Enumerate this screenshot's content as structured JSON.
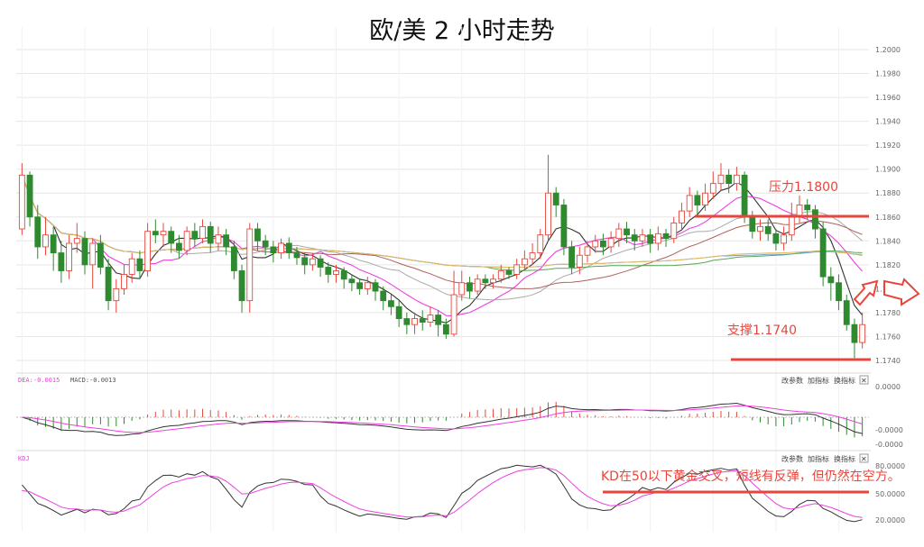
{
  "title": "欧/美 2 小时走势",
  "chart_data": [
    {
      "type": "candlestick",
      "panel": "price",
      "ylim": [
        1.174,
        1.2
      ],
      "yticks": [
        "1.2000",
        "1.1980",
        "1.1960",
        "1.1940",
        "1.1920",
        "1.1900",
        "1.1880",
        "1.1860",
        "1.1840",
        "1.1820",
        "1.1800",
        "1.1780",
        "1.1760",
        "1.1740"
      ],
      "candles": [
        [
          1.185,
          1.1895,
          1.1905,
          1.1845
        ],
        [
          1.1895,
          1.186,
          1.1898,
          1.1852
        ],
        [
          1.186,
          1.1835,
          1.187,
          1.1825
        ],
        [
          1.1835,
          1.1845,
          1.186,
          1.1828
        ],
        [
          1.1845,
          1.183,
          1.1852,
          1.1815
        ],
        [
          1.183,
          1.1815,
          1.184,
          1.1805
        ],
        [
          1.1815,
          1.1838,
          1.1845,
          1.1808
        ],
        [
          1.1838,
          1.1842,
          1.1855,
          1.183
        ],
        [
          1.1842,
          1.182,
          1.1848,
          1.1812
        ],
        [
          1.182,
          1.1838,
          1.1842,
          1.18
        ],
        [
          1.1838,
          1.1818,
          1.1845,
          1.1812
        ],
        [
          1.1818,
          1.179,
          1.1825,
          1.1782
        ],
        [
          1.179,
          1.18,
          1.1808,
          1.178
        ],
        [
          1.18,
          1.1812,
          1.182,
          1.1795
        ],
        [
          1.1812,
          1.1825,
          1.183,
          1.1805
        ],
        [
          1.1825,
          1.1815,
          1.1832,
          1.1808
        ],
        [
          1.1815,
          1.1848,
          1.1855,
          1.181
        ],
        [
          1.1848,
          1.1845,
          1.1858,
          1.1838
        ],
        [
          1.1845,
          1.1848,
          1.1855,
          1.1835
        ],
        [
          1.1848,
          1.1838,
          1.1852,
          1.183
        ],
        [
          1.1838,
          1.1832,
          1.1845,
          1.1825
        ],
        [
          1.1832,
          1.1848,
          1.1852,
          1.1828
        ],
        [
          1.1848,
          1.1842,
          1.1855,
          1.1835
        ],
        [
          1.1842,
          1.1852,
          1.1858,
          1.1838
        ],
        [
          1.1852,
          1.1838,
          1.1856,
          1.183
        ],
        [
          1.1838,
          1.1845,
          1.1852,
          1.1832
        ],
        [
          1.1845,
          1.1835,
          1.185,
          1.1828
        ],
        [
          1.1835,
          1.1815,
          1.184,
          1.1808
        ],
        [
          1.1815,
          1.179,
          1.182,
          1.178
        ],
        [
          1.179,
          1.185,
          1.1855,
          1.178
        ],
        [
          1.185,
          1.184,
          1.1855,
          1.1832
        ],
        [
          1.184,
          1.1835,
          1.1845,
          1.1828
        ],
        [
          1.1835,
          1.183,
          1.184,
          1.1822
        ],
        [
          1.183,
          1.1838,
          1.1842,
          1.1825
        ],
        [
          1.1838,
          1.183,
          1.1843,
          1.1825
        ],
        [
          1.183,
          1.1826,
          1.1835,
          1.182
        ],
        [
          1.1826,
          1.182,
          1.183,
          1.1812
        ],
        [
          1.182,
          1.1825,
          1.183,
          1.1815
        ],
        [
          1.1825,
          1.1818,
          1.1828,
          1.181
        ],
        [
          1.1818,
          1.1812,
          1.1822,
          1.1805
        ],
        [
          1.1812,
          1.1815,
          1.182,
          1.1805
        ],
        [
          1.1815,
          1.1808,
          1.1818,
          1.18
        ],
        [
          1.1808,
          1.1805,
          1.1812,
          1.1798
        ],
        [
          1.1805,
          1.18,
          1.1808,
          1.1795
        ],
        [
          1.18,
          1.1805,
          1.181,
          1.1795
        ],
        [
          1.1805,
          1.1798,
          1.1808,
          1.179
        ],
        [
          1.1798,
          1.179,
          1.1802,
          1.1782
        ],
        [
          1.179,
          1.1785,
          1.1795,
          1.1778
        ],
        [
          1.1785,
          1.1775,
          1.179,
          1.1768
        ],
        [
          1.1775,
          1.177,
          1.178,
          1.1762
        ],
        [
          1.177,
          1.1775,
          1.178,
          1.1762
        ],
        [
          1.1775,
          1.1772,
          1.1782,
          1.1765
        ],
        [
          1.1772,
          1.1778,
          1.1785,
          1.1768
        ],
        [
          1.1778,
          1.177,
          1.1782,
          1.176
        ],
        [
          1.177,
          1.1762,
          1.1775,
          1.1758
        ],
        [
          1.1762,
          1.1795,
          1.1815,
          1.176
        ],
        [
          1.1795,
          1.1805,
          1.1815,
          1.179
        ],
        [
          1.1805,
          1.1798,
          1.181,
          1.1792
        ],
        [
          1.1798,
          1.1808,
          1.1812,
          1.1795
        ],
        [
          1.1808,
          1.1805,
          1.1812,
          1.18
        ],
        [
          1.1805,
          1.1808,
          1.1812,
          1.18
        ],
        [
          1.1808,
          1.1815,
          1.182,
          1.1805
        ],
        [
          1.1815,
          1.1812,
          1.1818,
          1.1808
        ],
        [
          1.1812,
          1.182,
          1.1825,
          1.1808
        ],
        [
          1.182,
          1.1825,
          1.1832,
          1.1815
        ],
        [
          1.1825,
          1.183,
          1.1838,
          1.182
        ],
        [
          1.183,
          1.1845,
          1.185,
          1.1825
        ],
        [
          1.1845,
          1.188,
          1.1912,
          1.184
        ],
        [
          1.188,
          1.187,
          1.1885,
          1.186
        ],
        [
          1.187,
          1.1835,
          1.1875,
          1.1828
        ],
        [
          1.1835,
          1.1818,
          1.184,
          1.1812
        ],
        [
          1.1818,
          1.1828,
          1.1835,
          1.1812
        ],
        [
          1.1828,
          1.1835,
          1.184,
          1.1822
        ],
        [
          1.1835,
          1.184,
          1.1845,
          1.183
        ],
        [
          1.184,
          1.1835,
          1.1846,
          1.1828
        ],
        [
          1.1835,
          1.1842,
          1.1848,
          1.183
        ],
        [
          1.1842,
          1.185,
          1.1855,
          1.1835
        ],
        [
          1.185,
          1.1845,
          1.1856,
          1.1838
        ],
        [
          1.1845,
          1.184,
          1.185,
          1.1832
        ],
        [
          1.184,
          1.1845,
          1.185,
          1.1835
        ],
        [
          1.1845,
          1.1838,
          1.185,
          1.183
        ],
        [
          1.1838,
          1.1846,
          1.1852,
          1.1832
        ],
        [
          1.1846,
          1.1842,
          1.185,
          1.1835
        ],
        [
          1.1842,
          1.1855,
          1.186,
          1.1838
        ],
        [
          1.1855,
          1.1865,
          1.1872,
          1.185
        ],
        [
          1.1865,
          1.1878,
          1.1885,
          1.186
        ],
        [
          1.1878,
          1.187,
          1.1882,
          1.1862
        ],
        [
          1.187,
          1.188,
          1.1888,
          1.1865
        ],
        [
          1.188,
          1.1888,
          1.1898,
          1.1875
        ],
        [
          1.1888,
          1.1895,
          1.1905,
          1.1882
        ],
        [
          1.1895,
          1.1888,
          1.19,
          1.188
        ],
        [
          1.1888,
          1.1895,
          1.1902,
          1.1882
        ],
        [
          1.1895,
          1.186,
          1.1898,
          1.1855
        ],
        [
          1.186,
          1.1848,
          1.1865,
          1.1842
        ],
        [
          1.1848,
          1.1852,
          1.1858,
          1.184
        ],
        [
          1.1852,
          1.1846,
          1.1858,
          1.184
        ],
        [
          1.1846,
          1.1838,
          1.185,
          1.1832
        ],
        [
          1.1838,
          1.1845,
          1.1852,
          1.1832
        ],
        [
          1.1845,
          1.186,
          1.1872,
          1.184
        ],
        [
          1.186,
          1.187,
          1.1878,
          1.1855
        ],
        [
          1.187,
          1.1866,
          1.1875,
          1.1858
        ],
        [
          1.1866,
          1.185,
          1.187,
          1.1842
        ],
        [
          1.185,
          1.181,
          1.1856,
          1.1802
        ],
        [
          1.181,
          1.1805,
          1.1818,
          1.179
        ],
        [
          1.1805,
          1.179,
          1.1812,
          1.1782
        ],
        [
          1.179,
          1.177,
          1.1795,
          1.1765
        ],
        [
          1.177,
          1.1755,
          1.1775,
          1.1742
        ],
        [
          1.1755,
          1.177,
          1.178,
          1.175
        ]
      ],
      "annotations": {
        "resistance": {
          "label": "压力1.1800",
          "level": 1.186
        },
        "support": {
          "label": "支撑1.1740",
          "level": 1.1742
        }
      }
    },
    {
      "type": "macd",
      "panel": "macd",
      "legend_dea": "DEA:-0.0015",
      "legend_macd": "MACD:-0.0013",
      "yticks": [
        "0.0000",
        "-0.0000",
        "-0.0000"
      ]
    },
    {
      "type": "kd",
      "panel": "kd",
      "legend": "KDJ",
      "yticks": [
        "80.0000",
        "50.0000",
        "20.0000"
      ],
      "note": "KD在50以下黄金交叉，短线有反弹，但仍然在空方。"
    }
  ],
  "toolbar": {
    "b1": "改参数",
    "b2": "加指标",
    "b3": "换指标",
    "close": "✕"
  },
  "colors": {
    "up": "#e8463c",
    "down": "#2f8a2f",
    "pink": "#ee3fe0",
    "dark": "#333333",
    "grid": "#e6e6e6",
    "ann": "#e8463c"
  }
}
